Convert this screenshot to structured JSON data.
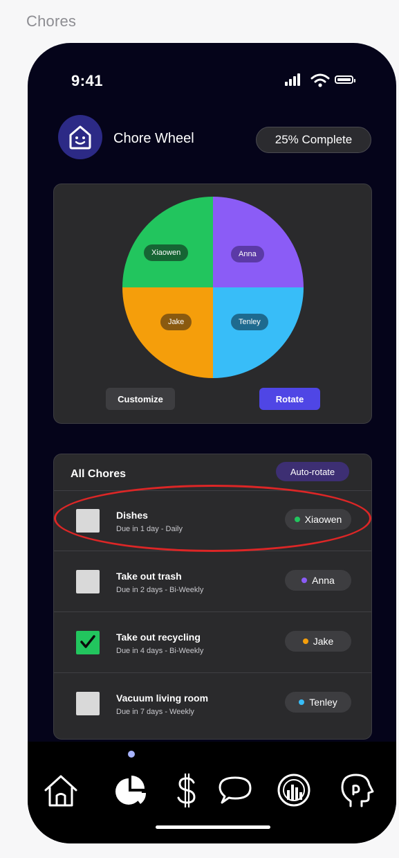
{
  "frame_title": "Chores",
  "status_bar": {
    "time": "9:41"
  },
  "header": {
    "app_title": "Chore Wheel",
    "logo_icon": "smiling-house-icon",
    "progress_label": "25% Complete",
    "progress_fraction": 0.25
  },
  "wheel": {
    "segments": [
      {
        "name": "Xiaowen",
        "color": "#22c55e",
        "label_bg": "#166534"
      },
      {
        "name": "Anna",
        "color": "#8b5cf6",
        "label_bg": "#5b3aa6"
      },
      {
        "name": "Tenley",
        "color": "#38bdf8",
        "label_bg": "#1e6a8f"
      },
      {
        "name": "Jake",
        "color": "#f59e0b",
        "label_bg": "#8a5a10"
      }
    ],
    "customize_label": "Customize",
    "rotate_label": "Rotate"
  },
  "chores": {
    "heading": "All Chores",
    "auto_rotate_label": "Auto-rotate",
    "items": [
      {
        "name": "Dishes",
        "due": "Due in 1 day - Daily",
        "assignee": "Xiaowen",
        "dot_color": "#22c55e",
        "done": false
      },
      {
        "name": "Take out trash",
        "due": "Due in 2 days - Bi-Weekly",
        "assignee": "Anna",
        "dot_color": "#8b5cf6",
        "done": false
      },
      {
        "name": "Take out recycling",
        "due": "Due in 4 days - Bi-Weekly",
        "assignee": "Jake",
        "dot_color": "#f59e0b",
        "done": true
      },
      {
        "name": "Vacuum living room",
        "due": "Due in 7 days - Weekly",
        "assignee": "Tenley",
        "dot_color": "#38bdf8",
        "done": false
      }
    ]
  },
  "tab_bar": {
    "items": [
      {
        "icon": "home-icon",
        "active": false
      },
      {
        "icon": "pie-chart-icon",
        "active": true
      },
      {
        "icon": "dollar-icon",
        "active": false
      },
      {
        "icon": "chat-bubble-icon",
        "active": false
      },
      {
        "icon": "analytics-icon",
        "active": false
      },
      {
        "icon": "profile-face-icon",
        "active": false
      }
    ]
  },
  "colors": {
    "background": "#05041a",
    "card": "#2a2a2c",
    "accent": "#4f46e5",
    "highlight_ring": "#dc2626"
  }
}
